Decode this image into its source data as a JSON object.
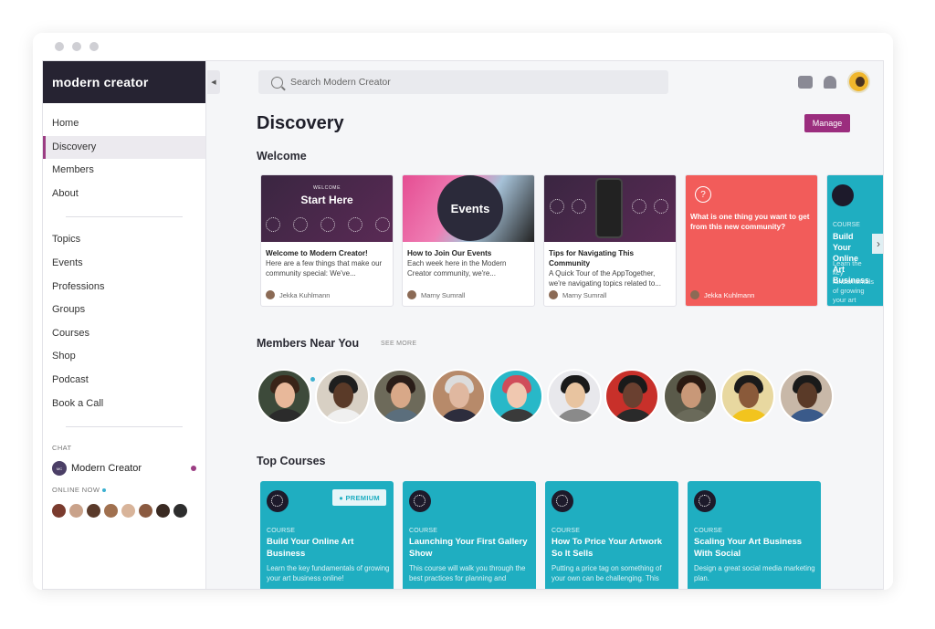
{
  "brand": {
    "name": "modern creator"
  },
  "sidebar": {
    "nav_primary": [
      {
        "label": "Home"
      },
      {
        "label": "Discovery",
        "active": true
      },
      {
        "label": "Members"
      },
      {
        "label": "About"
      }
    ],
    "nav_secondary": [
      {
        "label": "Topics"
      },
      {
        "label": "Events"
      },
      {
        "label": "Professions"
      },
      {
        "label": "Groups"
      },
      {
        "label": "Courses"
      },
      {
        "label": "Shop"
      },
      {
        "label": "Podcast"
      },
      {
        "label": "Book a Call"
      }
    ],
    "chat_heading": "CHAT",
    "chat_name": "Modern Creator",
    "online_heading": "ONLINE NOW",
    "online_avatar_colors": [
      "#7a3b2e",
      "#c9a28a",
      "#5a3a2a",
      "#a0704f",
      "#d8b49a",
      "#8a5a40",
      "#3a2a22",
      "#2d2d2d"
    ]
  },
  "search": {
    "placeholder": "Search Modern Creator",
    "icon": "search-icon"
  },
  "header": {
    "title": "Discovery",
    "manage_label": "Manage"
  },
  "sections": {
    "welcome": "Welcome",
    "members_near": "Members Near You",
    "see_more": "SEE MORE",
    "top_courses": "Top Courses"
  },
  "welcome_cards": [
    {
      "banner_small": "WELCOME",
      "banner_big": "Start Here",
      "title": "Welcome to Modern Creator!",
      "desc": "Here are a few things that make our community special: We've...",
      "author": "Jekka Kuhlmann"
    },
    {
      "banner_big": "Events",
      "title": "How to Join Our Events",
      "desc": "Each week here in the Modern Creator community, we're...",
      "author": "Marny Sumrall"
    },
    {
      "title": "Tips for Navigating This Community",
      "desc": "A Quick Tour of the AppTogether, we're navigating topics related to...",
      "author": "Marny Sumrall"
    },
    {
      "question": "What is one thing you want to get from this new community?",
      "author": "Jekka Kuhlmann"
    },
    {
      "label": "COURSE",
      "title": "Build Your Online Art Business",
      "desc": "Learn the key fundamentals of growing your art business online!"
    }
  ],
  "members": [
    {
      "bg": "#3d4a3a",
      "skin": "#e8b89a",
      "hair": "#3a2418",
      "shirt": "#2b2b2b"
    },
    {
      "bg": "#d8d0c4",
      "skin": "#5a3a28",
      "hair": "#1e1e1e",
      "shirt": "#f0f0f0"
    },
    {
      "bg": "#6d6a5a",
      "skin": "#d8a888",
      "hair": "#2a1d18",
      "shirt": "#5b6e7c"
    },
    {
      "bg": "#b78a6a",
      "skin": "#e0b8a0",
      "hair": "#dcdcdc",
      "shirt": "#2d2d3d"
    },
    {
      "bg": "#28b8c8",
      "skin": "#f0c8b0",
      "hair": "#d04d5a",
      "shirt": "#3a3a3a"
    },
    {
      "bg": "#e8e8ec",
      "skin": "#e8c4a0",
      "hair": "#1a1a1a",
      "shirt": "#8a8a8a"
    },
    {
      "bg": "#c8302a",
      "skin": "#6a4030",
      "hair": "#1a1a1a",
      "shirt": "#2a2a2a"
    },
    {
      "bg": "#5a5a4a",
      "skin": "#c89878",
      "hair": "#2a1a12",
      "shirt": "#6a6a5a"
    },
    {
      "bg": "#e8d8a0",
      "skin": "#8a5a3a",
      "hair": "#1a1a1a",
      "shirt": "#f2c41e"
    },
    {
      "bg": "#c8b8a8",
      "skin": "#5a3a28",
      "hair": "#1a1a1a",
      "shirt": "#3a5a8a"
    }
  ],
  "courses": [
    {
      "label": "COURSE",
      "title": "Build Your Online Art Business",
      "desc": "Learn the key fundamentals of growing your art business online!",
      "premium": "PREMIUM"
    },
    {
      "label": "COURSE",
      "title": "Launching Your First Gallery Show",
      "desc": "This course will walk you through the best practices for planning and"
    },
    {
      "label": "COURSE",
      "title": "How To Price Your Artwork So It Sells",
      "desc": "Putting a price tag on something of your own can be challenging. This"
    },
    {
      "label": "COURSE",
      "title": "Scaling Your Art Business With Social",
      "desc": "Design a great social media marketing plan."
    }
  ],
  "colors": {
    "brand_dark": "#262332",
    "accent": "#9b2d7e",
    "teal": "#1faec1",
    "coral": "#f25c5a"
  }
}
